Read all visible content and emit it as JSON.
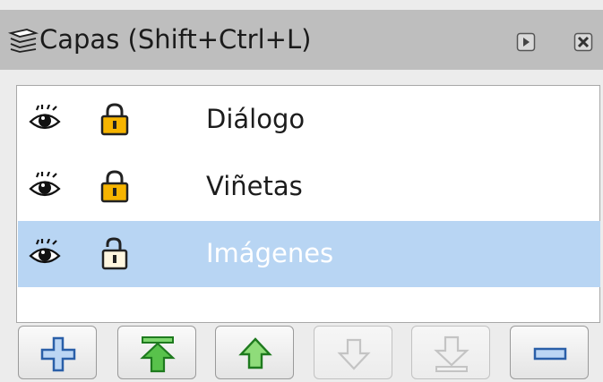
{
  "panel": {
    "title": "Capas (Shift+Ctrl+L)"
  },
  "layers": [
    {
      "name": "Diálogo",
      "visible": true,
      "locked": true,
      "selected": false
    },
    {
      "name": "Viñetas",
      "visible": true,
      "locked": true,
      "selected": false
    },
    {
      "name": "Imágenes",
      "visible": true,
      "locked": false,
      "selected": true
    }
  ],
  "toolbar": {
    "buttons": [
      {
        "icon": "plus-icon",
        "enabled": true
      },
      {
        "icon": "move-to-top-icon",
        "enabled": true
      },
      {
        "icon": "move-up-icon",
        "enabled": true
      },
      {
        "icon": "move-down-icon",
        "enabled": false
      },
      {
        "icon": "move-to-bottom-icon",
        "enabled": false
      },
      {
        "icon": "minus-icon",
        "enabled": true
      }
    ]
  },
  "colors": {
    "selection": "#b8d5f3",
    "titlebar": "#bebebe",
    "lock": "#f6b400",
    "arrow_green": "#3cb23c"
  }
}
